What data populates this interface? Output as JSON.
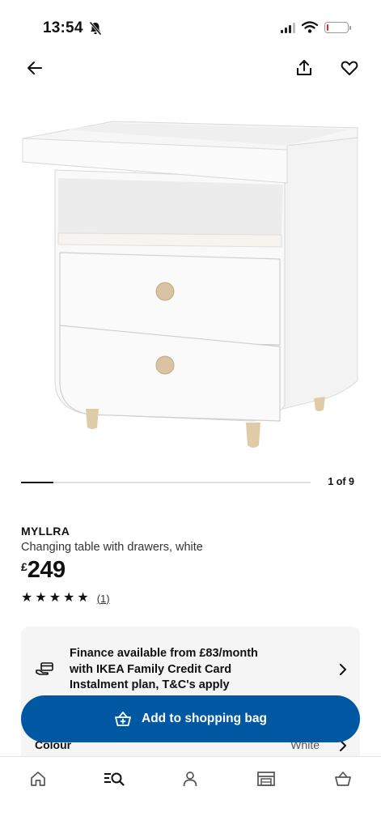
{
  "status_bar": {
    "time": "13:54",
    "silent_icon": "bell-off-icon",
    "signal_icon": "cellular-signal-icon",
    "wifi_icon": "wifi-icon",
    "battery_icon": "battery-low-icon",
    "battery_level": 0.08,
    "battery_color": "#e02424"
  },
  "top_nav": {
    "back_icon": "arrow-left-icon",
    "share_icon": "share-icon",
    "favourite_icon": "heart-icon"
  },
  "gallery": {
    "image_subject": "white changing table with two drawers",
    "counter": "1 of 9",
    "current": 1,
    "total": 9
  },
  "product": {
    "name": "MYLLRA",
    "description": "Changing table with drawers, white",
    "currency_symbol": "£",
    "price": "249",
    "rating_stars": 5,
    "rating_count": "(1)"
  },
  "finance": {
    "icon": "credit-card-hand-icon",
    "lines": [
      "Finance available from £83/month",
      "with IKEA Family Credit Card",
      "Instalment plan, T&C's apply"
    ]
  },
  "colour": {
    "label": "Colour",
    "value": "White"
  },
  "cta": {
    "label": "Add to shopping bag",
    "icon": "shopping-bag-add-icon",
    "color": "#0058a3"
  },
  "bottom_nav": {
    "items": [
      "home-icon",
      "search-icon",
      "profile-icon",
      "store-icon",
      "shopping-bag-icon"
    ],
    "active": "search-icon"
  }
}
